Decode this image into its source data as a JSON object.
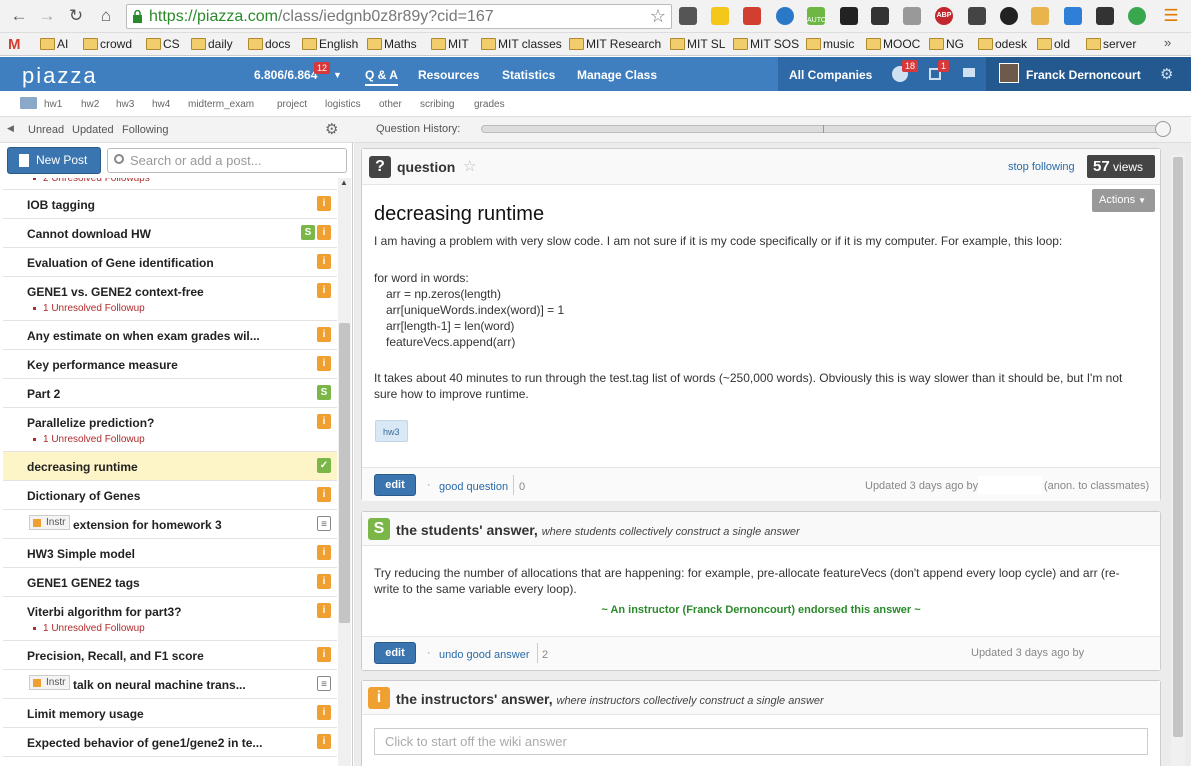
{
  "browser": {
    "url_scheme": "https://",
    "url_host": "piazza.com",
    "url_path": "/class/iedgnb0z8r89y?cid=167",
    "ext_auto": "AUTO",
    "ext_abp": "ABP"
  },
  "bookmarks": [
    "AI",
    "crowd",
    "CS",
    "daily",
    "docs",
    "English",
    "Maths",
    "MIT",
    "MIT classes",
    "MIT Research",
    "MIT SL",
    "MIT SOS",
    "music",
    "MOOC",
    "NG",
    "odesk",
    "old",
    "server"
  ],
  "bookmarks_gmail": "M",
  "bookmarks_more": "»",
  "nav": {
    "logo": "piazza",
    "course": "6.806/6.864",
    "course_badge": "12",
    "qa": "Q & A",
    "resources": "Resources",
    "statistics": "Statistics",
    "manage": "Manage Class",
    "all_companies": "All Companies",
    "globe_badge": "18",
    "cal_badge": "1",
    "user": "Franck Dernoncourt"
  },
  "folders": [
    "hw1",
    "hw2",
    "hw3",
    "hw4",
    "midterm_exam",
    "project",
    "logistics",
    "other",
    "scribing",
    "grades"
  ],
  "filters": {
    "unread": "Unread",
    "updated": "Updated",
    "following": "Following",
    "history_label": "Question History:"
  },
  "left": {
    "new_post": "New Post",
    "search_placeholder": "Search or add a post...",
    "partial_followups": "2 Unresolved Followups",
    "items": [
      {
        "title": "IOB tagging",
        "icons": [
          "i"
        ]
      },
      {
        "title": "Cannot download HW",
        "icons": [
          "s",
          "i"
        ]
      },
      {
        "title": "Evaluation of Gene identification",
        "icons": [
          "i"
        ]
      },
      {
        "title": "GENE1 vs. GENE2 context-free",
        "followup": "1 Unresolved Followup",
        "icons": [
          "i"
        ]
      },
      {
        "title": "Any estimate on when exam grades wil...",
        "icons": [
          "i"
        ]
      },
      {
        "title": "Key performance measure",
        "icons": [
          "i"
        ]
      },
      {
        "title": "Part 2",
        "icons": [
          "s"
        ]
      },
      {
        "title": "Parallelize prediction?",
        "followup": "1 Unresolved Followup",
        "icons": [
          "i"
        ]
      },
      {
        "title": "decreasing runtime",
        "icons": [
          "check"
        ],
        "selected": true
      },
      {
        "title": "Dictionary of Genes",
        "icons": [
          "i"
        ]
      },
      {
        "title": "extension for homework 3",
        "instr": "Instr",
        "icons": [
          "note"
        ]
      },
      {
        "title": "HW3 Simple model",
        "icons": [
          "i"
        ]
      },
      {
        "title": "GENE1 GENE2 tags",
        "icons": [
          "i"
        ]
      },
      {
        "title": "Viterbi algorithm for part3?",
        "followup": "1 Unresolved Followup",
        "icons": [
          "i"
        ]
      },
      {
        "title": "Precision, Recall, and F1 score",
        "icons": [
          "i"
        ]
      },
      {
        "title": "talk on neural machine trans...",
        "instr": "Instr",
        "icons": [
          "note"
        ]
      },
      {
        "title": "Limit memory usage",
        "icons": [
          "i"
        ]
      },
      {
        "title": "Expected behavior of gene1/gene2 in te...",
        "icons": [
          "i"
        ]
      }
    ]
  },
  "question": {
    "kind": "question",
    "stop_following": "stop following",
    "views_count": "57",
    "views_label": "views",
    "actions": "Actions",
    "title": "decreasing runtime",
    "intro": "I am having a problem with very slow code. I am not sure if it is my code specifically or if it is my computer. For example, this loop:",
    "code": [
      "for word in words:",
      "arr = np.zeros(length)",
      "arr[uniqueWords.index(word)] = 1",
      "arr[length-1] = len(word)",
      "featureVecs.append(arr)"
    ],
    "outro": "It takes about 40 minutes to run through the test.tag list of words (~250,000 words). Obviously this is way slower than it should be, but I'm not sure how to improve runtime.",
    "tag": "hw3",
    "edit": "edit",
    "good": "good question",
    "good_count": "0",
    "updated": "Updated 3 days ago by",
    "anon": "(anon. to classmates)"
  },
  "students": {
    "icon": "S",
    "head": "the students' answer,",
    "sub": "where students collectively construct a single answer",
    "body": "Try reducing the number of allocations that are happening: for example, pre-allocate featureVecs (don't append every loop cycle) and arr (re-write to the same variable every loop).",
    "endorse": "~ An instructor (Franck Dernoncourt) endorsed this answer ~",
    "edit": "edit",
    "undo": "undo good answer",
    "count": "2",
    "updated": "Updated 3 days ago by"
  },
  "instructors": {
    "icon": "i",
    "head": "the instructors' answer,",
    "sub": "where instructors collectively construct a single answer",
    "placeholder": "Click to start off the wiki answer"
  }
}
